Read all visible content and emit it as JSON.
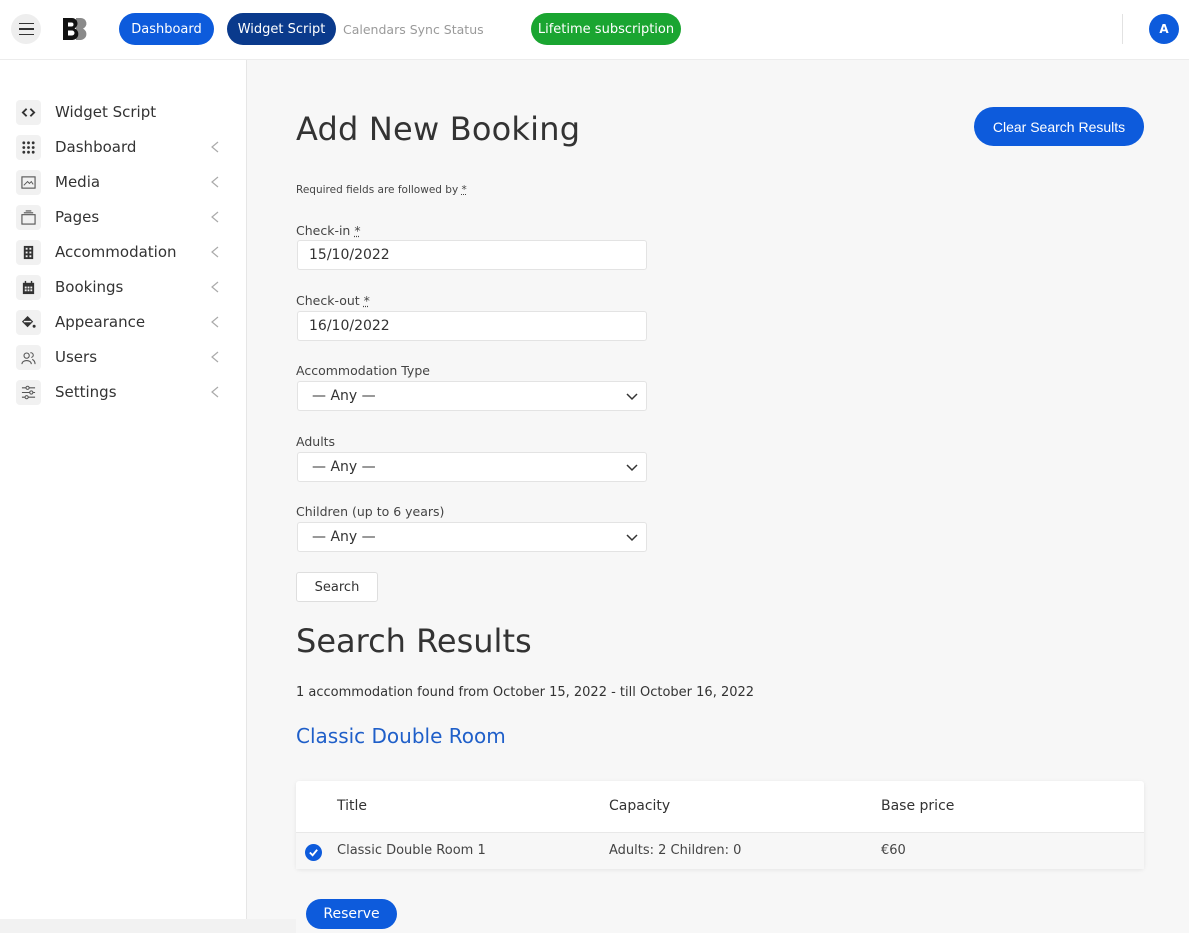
{
  "topbar": {
    "menu_icon": "hamburger-icon",
    "logo": "BB",
    "nav": [
      {
        "label": "Dashboard",
        "style": "primary"
      },
      {
        "label": "Widget Script",
        "style": "active"
      },
      {
        "label": "Calendars Sync Status",
        "style": "link"
      }
    ],
    "subscription_label": "Lifetime subscription",
    "avatar_initial": "A"
  },
  "colors": {
    "primary": "#0d5bdc",
    "active": "#0a3a8c",
    "success": "#1aa531",
    "link": "#1f5fc9"
  },
  "sidebar": {
    "items": [
      {
        "label": "Widget Script",
        "icon": "code-icon",
        "has_chevron": false
      },
      {
        "label": "Dashboard",
        "icon": "grid-icon",
        "has_chevron": true
      },
      {
        "label": "Media",
        "icon": "image-icon",
        "has_chevron": true
      },
      {
        "label": "Pages",
        "icon": "pages-icon",
        "has_chevron": true
      },
      {
        "label": "Accommodation",
        "icon": "building-icon",
        "has_chevron": true
      },
      {
        "label": "Bookings",
        "icon": "calendar-icon",
        "has_chevron": true
      },
      {
        "label": "Appearance",
        "icon": "paint-bucket-icon",
        "has_chevron": true
      },
      {
        "label": "Users",
        "icon": "users-icon",
        "has_chevron": true
      },
      {
        "label": "Settings",
        "icon": "sliders-icon",
        "has_chevron": true
      }
    ]
  },
  "main": {
    "title": "Add New Booking",
    "clear_button": "Clear Search Results",
    "required_note": "Required fields are followed by",
    "required_marker": "*",
    "form": {
      "checkin_label": "Check-in",
      "checkin_value": "15/10/2022",
      "checkout_label": "Check-out",
      "checkout_value": "16/10/2022",
      "accommodation_type_label": "Accommodation Type",
      "accommodation_type_value": "— Any —",
      "adults_label": "Adults",
      "adults_value": "— Any —",
      "children_label": "Children (up to 6 years)",
      "children_value": "— Any —",
      "search_button": "Search"
    },
    "results": {
      "title": "Search Results",
      "summary": "1 accommodation found from October 15, 2022 - till October 16, 2022",
      "room_type": "Classic Double Room",
      "columns": [
        "Title",
        "Capacity",
        "Base price"
      ],
      "rows": [
        {
          "selected": true,
          "title": "Classic Double Room 1",
          "capacity": "Adults: 2 Children: 0",
          "price": "€60"
        }
      ],
      "reserve_button": "Reserve"
    }
  }
}
